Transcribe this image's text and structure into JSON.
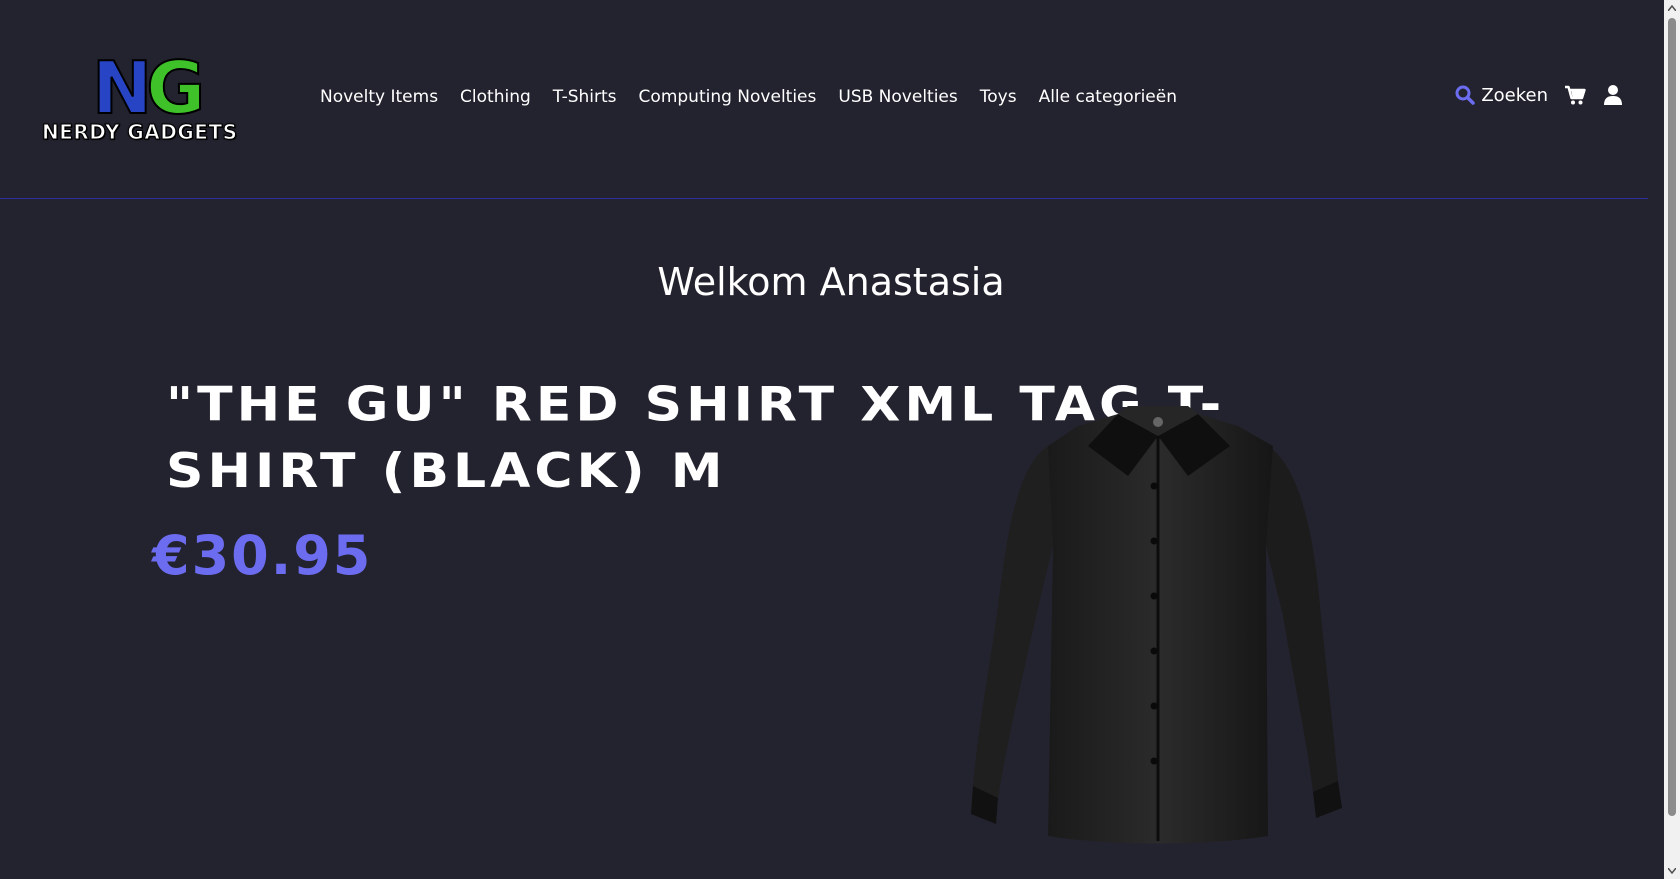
{
  "header": {
    "logo": {
      "letters_n": "N",
      "letters_g": "G",
      "wordmark": "NERDY GADGETS"
    },
    "nav": [
      {
        "label": "Novelty Items"
      },
      {
        "label": "Clothing"
      },
      {
        "label": "T-Shirts"
      },
      {
        "label": "Computing Novelties"
      },
      {
        "label": "USB Novelties"
      },
      {
        "label": "Toys"
      },
      {
        "label": "Alle categorieën"
      }
    ],
    "search_label": "Zoeken",
    "icons": {
      "search": "search-icon",
      "cart": "cart-icon",
      "user": "user-icon"
    }
  },
  "main": {
    "welcome": "Welkom Anastasia",
    "product": {
      "title": "\"The Gu\" red shirt XML tag t-shirt (Black) M",
      "price": "€30.95",
      "image": "black-shirt-image"
    }
  },
  "colors": {
    "background": "#23232f",
    "accent": "#6c6cf0",
    "divider": "#2e2ea3",
    "logo_n": "#2644c4",
    "logo_g": "#3fc12a"
  }
}
